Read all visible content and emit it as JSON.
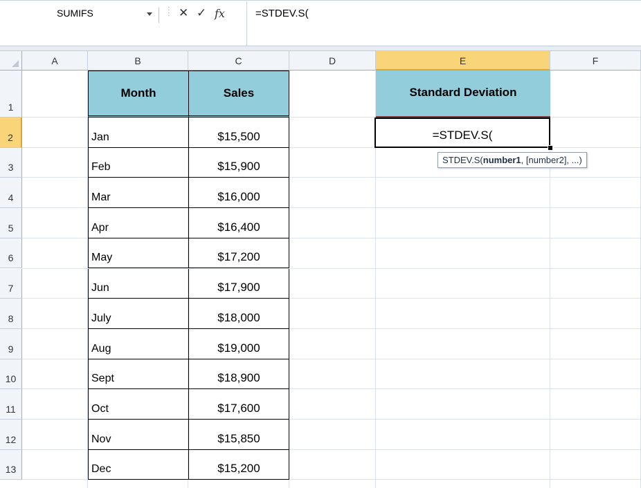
{
  "formula_bar": {
    "name_box": "SUMIFS",
    "cancel_icon": "cancel-x-icon",
    "enter_icon": "checkmark-icon",
    "function_icon": "fx",
    "formula": "=STDEV.S("
  },
  "columns": [
    "A",
    "B",
    "C",
    "D",
    "E",
    "F"
  ],
  "selected_column": "E",
  "rows": [
    "1",
    "2",
    "3",
    "4",
    "5",
    "6",
    "7",
    "8",
    "9",
    "10",
    "11",
    "12",
    "13"
  ],
  "selected_row": "2",
  "table": {
    "headers": [
      "Month",
      "Sales"
    ],
    "rows": [
      {
        "month": "Jan",
        "sales": "$15,500"
      },
      {
        "month": "Feb",
        "sales": "$15,900"
      },
      {
        "month": "Mar",
        "sales": "$16,000"
      },
      {
        "month": "Apr",
        "sales": "$16,400"
      },
      {
        "month": "May",
        "sales": "$17,200"
      },
      {
        "month": "Jun",
        "sales": "$17,900"
      },
      {
        "month": "July",
        "sales": "$18,000"
      },
      {
        "month": "Aug",
        "sales": "$19,000"
      },
      {
        "month": "Sept",
        "sales": "$18,900"
      },
      {
        "month": "Oct",
        "sales": "$17,600"
      },
      {
        "month": "Nov",
        "sales": "$15,850"
      },
      {
        "month": "Dec",
        "sales": "$15,200"
      }
    ]
  },
  "std_dev": {
    "header": "Standard Deviation",
    "active_cell_text": "=STDEV.S("
  },
  "tooltip": {
    "prefix": "STDEV.S(",
    "bold_arg": "number1",
    "rest": ", [number2], ...)"
  },
  "colors": {
    "header_fill": "#92cddc",
    "selected_header": "#f9d478"
  }
}
